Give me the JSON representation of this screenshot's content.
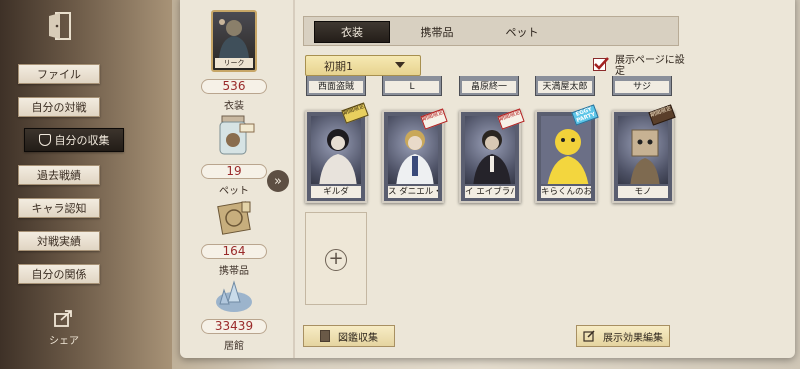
{
  "sidebar": {
    "items": [
      {
        "label": "ファイル"
      },
      {
        "label": "自分の対戦"
      },
      {
        "label": "自分の収集"
      },
      {
        "label": "過去戦績"
      },
      {
        "label": "キャラ認知"
      },
      {
        "label": "対戦実績"
      },
      {
        "label": "自分の関係"
      }
    ],
    "share_label": "シェア"
  },
  "stats": [
    {
      "value": "536",
      "label": "衣装",
      "portrait_label": "リーク"
    },
    {
      "value": "19",
      "label": "ペット"
    },
    {
      "value": "164",
      "label": "携帯品"
    },
    {
      "value": "33439",
      "label": "居館"
    }
  ],
  "tabs": [
    {
      "label": "衣装"
    },
    {
      "label": "携帯品"
    },
    {
      "label": "ペット"
    }
  ],
  "filter": {
    "selected": "初期1"
  },
  "display_toggle": {
    "label": "展示ページに設定",
    "checked": true
  },
  "ghost_row": [
    {
      "name": "西面盗賊"
    },
    {
      "name": "L"
    },
    {
      "name": "畠原終一"
    },
    {
      "name": "天満屋太郎"
    },
    {
      "name": "サジ"
    }
  ],
  "cards": [
    {
      "name": "ギルダ",
      "tag": "期間限定"
    },
    {
      "name": "ス ダニエル・ス",
      "tag": "期間限定"
    },
    {
      "name": "イ エイブラハム",
      "tag": "期間限定"
    },
    {
      "name": "キらくんのお友達",
      "tag": "EGGY PARTY"
    },
    {
      "name": "モノ",
      "tag": "期間限定"
    }
  ],
  "buttons": {
    "catalog": "図鑑収集",
    "effects": "展示効果編集"
  },
  "colors": {
    "stat_value": "#9a2a2a",
    "tab_active_bg": "#241e19",
    "dropdown_bg": "#e7d38f",
    "tag_red": "#b31e1e"
  }
}
